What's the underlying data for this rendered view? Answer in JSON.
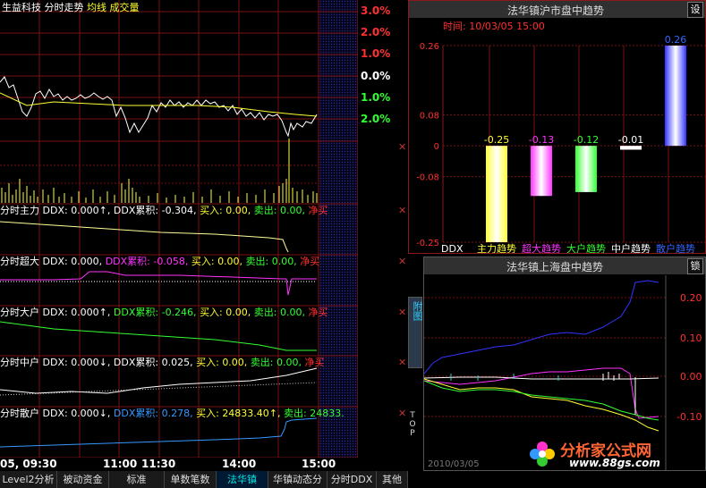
{
  "header": {
    "stock_name": "生益科技",
    "chart_name": "分时走势",
    "avg_line": "均线",
    "volume": "成交量"
  },
  "price_scale": [
    "3.0%",
    "2.0%",
    "1.0%",
    "0.0%",
    "1.0%",
    "2.0%"
  ],
  "price_scale_colors": [
    "#ff3030",
    "#ff3030",
    "#ff3030",
    "#ffffff",
    "#30ff30",
    "#30ff30"
  ],
  "subpanels": [
    {
      "title": "分时主力",
      "ddx_label": "DDX:",
      "ddx_value": "0.000↑,",
      "cum_label": "DDX累积:",
      "cum_value": "-0.304,",
      "buy_label": "买入:",
      "buy_value": "0.00,",
      "sell_label": "卖出:",
      "sell_value": "0.00,",
      "net_label": "净买"
    },
    {
      "title": "分时超大",
      "ddx_label": "DDX:",
      "ddx_value": "0.000,",
      "cum_label": "DDX累积:",
      "cum_value": "-0.058,",
      "buy_label": "买入:",
      "buy_value": "0.00,",
      "sell_label": "卖出:",
      "sell_value": "0.00,",
      "net_label": "净买"
    },
    {
      "title": "分时大户",
      "ddx_label": "DDX:",
      "ddx_value": "0.000↑,",
      "cum_label": "DDX累积:",
      "cum_value": "-0.246,",
      "buy_label": "买入:",
      "buy_value": "0.00,",
      "sell_label": "卖出:",
      "sell_value": "0.00,",
      "net_label": "净买"
    },
    {
      "title": "分时中户",
      "ddx_label": "DDX:",
      "ddx_value": "0.000↓,",
      "cum_label": "DDX累积:",
      "cum_value": "0.025,",
      "buy_label": "买入:",
      "buy_value": "0.00,",
      "sell_label": "卖出:",
      "sell_value": "0.00,",
      "net_label": "净买"
    },
    {
      "title": "分时散户",
      "ddx_label": "DDX:",
      "ddx_value": "0.000↓,",
      "cum_label": "DDX累积:",
      "cum_value": "0.278,",
      "buy_label": "买入:",
      "buy_value": "24833.40↑,",
      "sell_label": "卖出:",
      "sell_value": "24833.",
      "net_label": ""
    }
  ],
  "time_axis": [
    "05, 09:30",
    "11:00",
    "11:30",
    "14:00",
    "15:00"
  ],
  "right_top": {
    "title": "法华镇沪市盘中趋势",
    "settings_label": "设",
    "time_label": "时间:",
    "time_value": "10/03/05 15:00",
    "y_ticks": [
      "0.26",
      "0.08",
      "0",
      "-0.08",
      "-0.25"
    ],
    "x_axis_label": "DDX"
  },
  "chart_data": {
    "type": "bar",
    "categories": [
      "主力趋势",
      "超大趋势",
      "大户趋势",
      "中户趋势",
      "散户趋势"
    ],
    "values": [
      -0.25,
      -0.13,
      -0.12,
      -0.01,
      0.26
    ],
    "value_labels": [
      "-0.25",
      "-0.13",
      "-0.12",
      "-0.01",
      "0.26"
    ],
    "category_colors": [
      "#ffff33",
      "#ff33ff",
      "#33ff33",
      "#ffffff",
      "#3333ff"
    ],
    "label_colors": [
      "#ffff33",
      "#ff33ff",
      "#33ff33",
      "#ffffff",
      "#3366ff"
    ],
    "ylim": [
      -0.25,
      0.26
    ],
    "xlabel": "DDX",
    "ylabel": ""
  },
  "right_bottom": {
    "title": "法华镇上海盘中趋势",
    "lock_label": "锁",
    "y_ticks": [
      "0.20",
      "0.10",
      "0.00",
      "-0.10"
    ],
    "date": "2010/03/05"
  },
  "side_tabs": {
    "attach": "附图",
    "top": "TOP"
  },
  "watermark": {
    "cn": "分析家公式网",
    "url": "www.88gs.com"
  },
  "tabs": [
    "Level2分析",
    "被动资金",
    "标准",
    "单数笔数",
    "法华镇",
    "华镇动态分",
    "分时DDX",
    "其他"
  ],
  "active_tab": "法华镇"
}
